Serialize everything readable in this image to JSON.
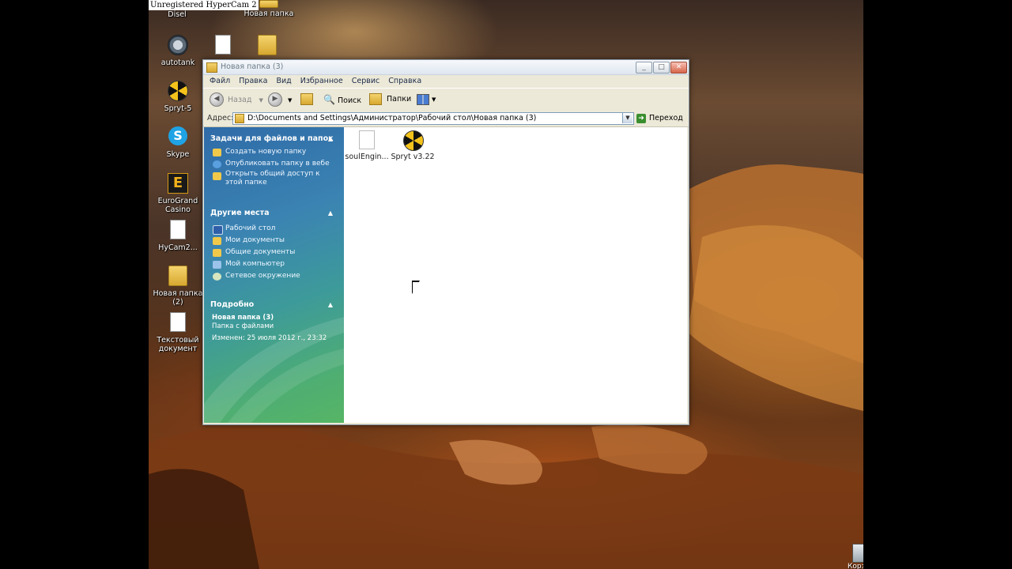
{
  "overlay": {
    "watermark": "Unregistered HyperCam 2"
  },
  "desktop": {
    "icons": [
      {
        "label": "Disel",
        "icon": "app-icon"
      },
      {
        "label": "Новая папка",
        "icon": "folder-icon"
      },
      {
        "label": "autotank",
        "icon": "autotank-icon"
      },
      {
        "label": "",
        "icon": "document-icon"
      },
      {
        "label": "",
        "icon": "folder-icon"
      },
      {
        "label": "Spryt-5",
        "icon": "radiation-icon"
      },
      {
        "label": "Skype",
        "icon": "skype-icon"
      },
      {
        "label": "EuroGrand Casino",
        "icon": "casino-icon"
      },
      {
        "label": "HyCam2...",
        "icon": "document-icon"
      },
      {
        "label": "Новая папка (2)",
        "icon": "folder-icon"
      },
      {
        "label": "Текстовый документ",
        "icon": "text-document-icon"
      }
    ],
    "recycle_label": "Корз..."
  },
  "window": {
    "title": "Новая папка (3)",
    "menu": [
      "Файл",
      "Правка",
      "Вид",
      "Избранное",
      "Сервис",
      "Справка"
    ],
    "toolbar": {
      "back": "Назад",
      "search": "Поиск",
      "folders": "Папки"
    },
    "address": {
      "label": "Адрес:",
      "path": "D:\\Documents and Settings\\Администратор\\Рабочий стол\\Новая папка (3)",
      "go": "Переход"
    },
    "taskpane": {
      "tasks_header": "Задачи для файлов и папок",
      "tasks": [
        "Создать новую папку",
        "Опубликовать папку в вебе",
        "Открыть общий доступ к этой папке"
      ],
      "places_header": "Другие места",
      "places": [
        "Рабочий стол",
        "Мои документы",
        "Общие документы",
        "Мой компьютер",
        "Сетевое окружение"
      ],
      "details_header": "Подробно",
      "details": {
        "name": "Новая папка (3)",
        "type": "Папка с файлами",
        "modified": "Изменен: 25 июля 2012 г., 23:32"
      }
    },
    "files": [
      {
        "name": "soulEngin...",
        "icon": "blank-file-icon"
      },
      {
        "name": "Spryt v3.22",
        "icon": "radiation-icon"
      }
    ]
  }
}
